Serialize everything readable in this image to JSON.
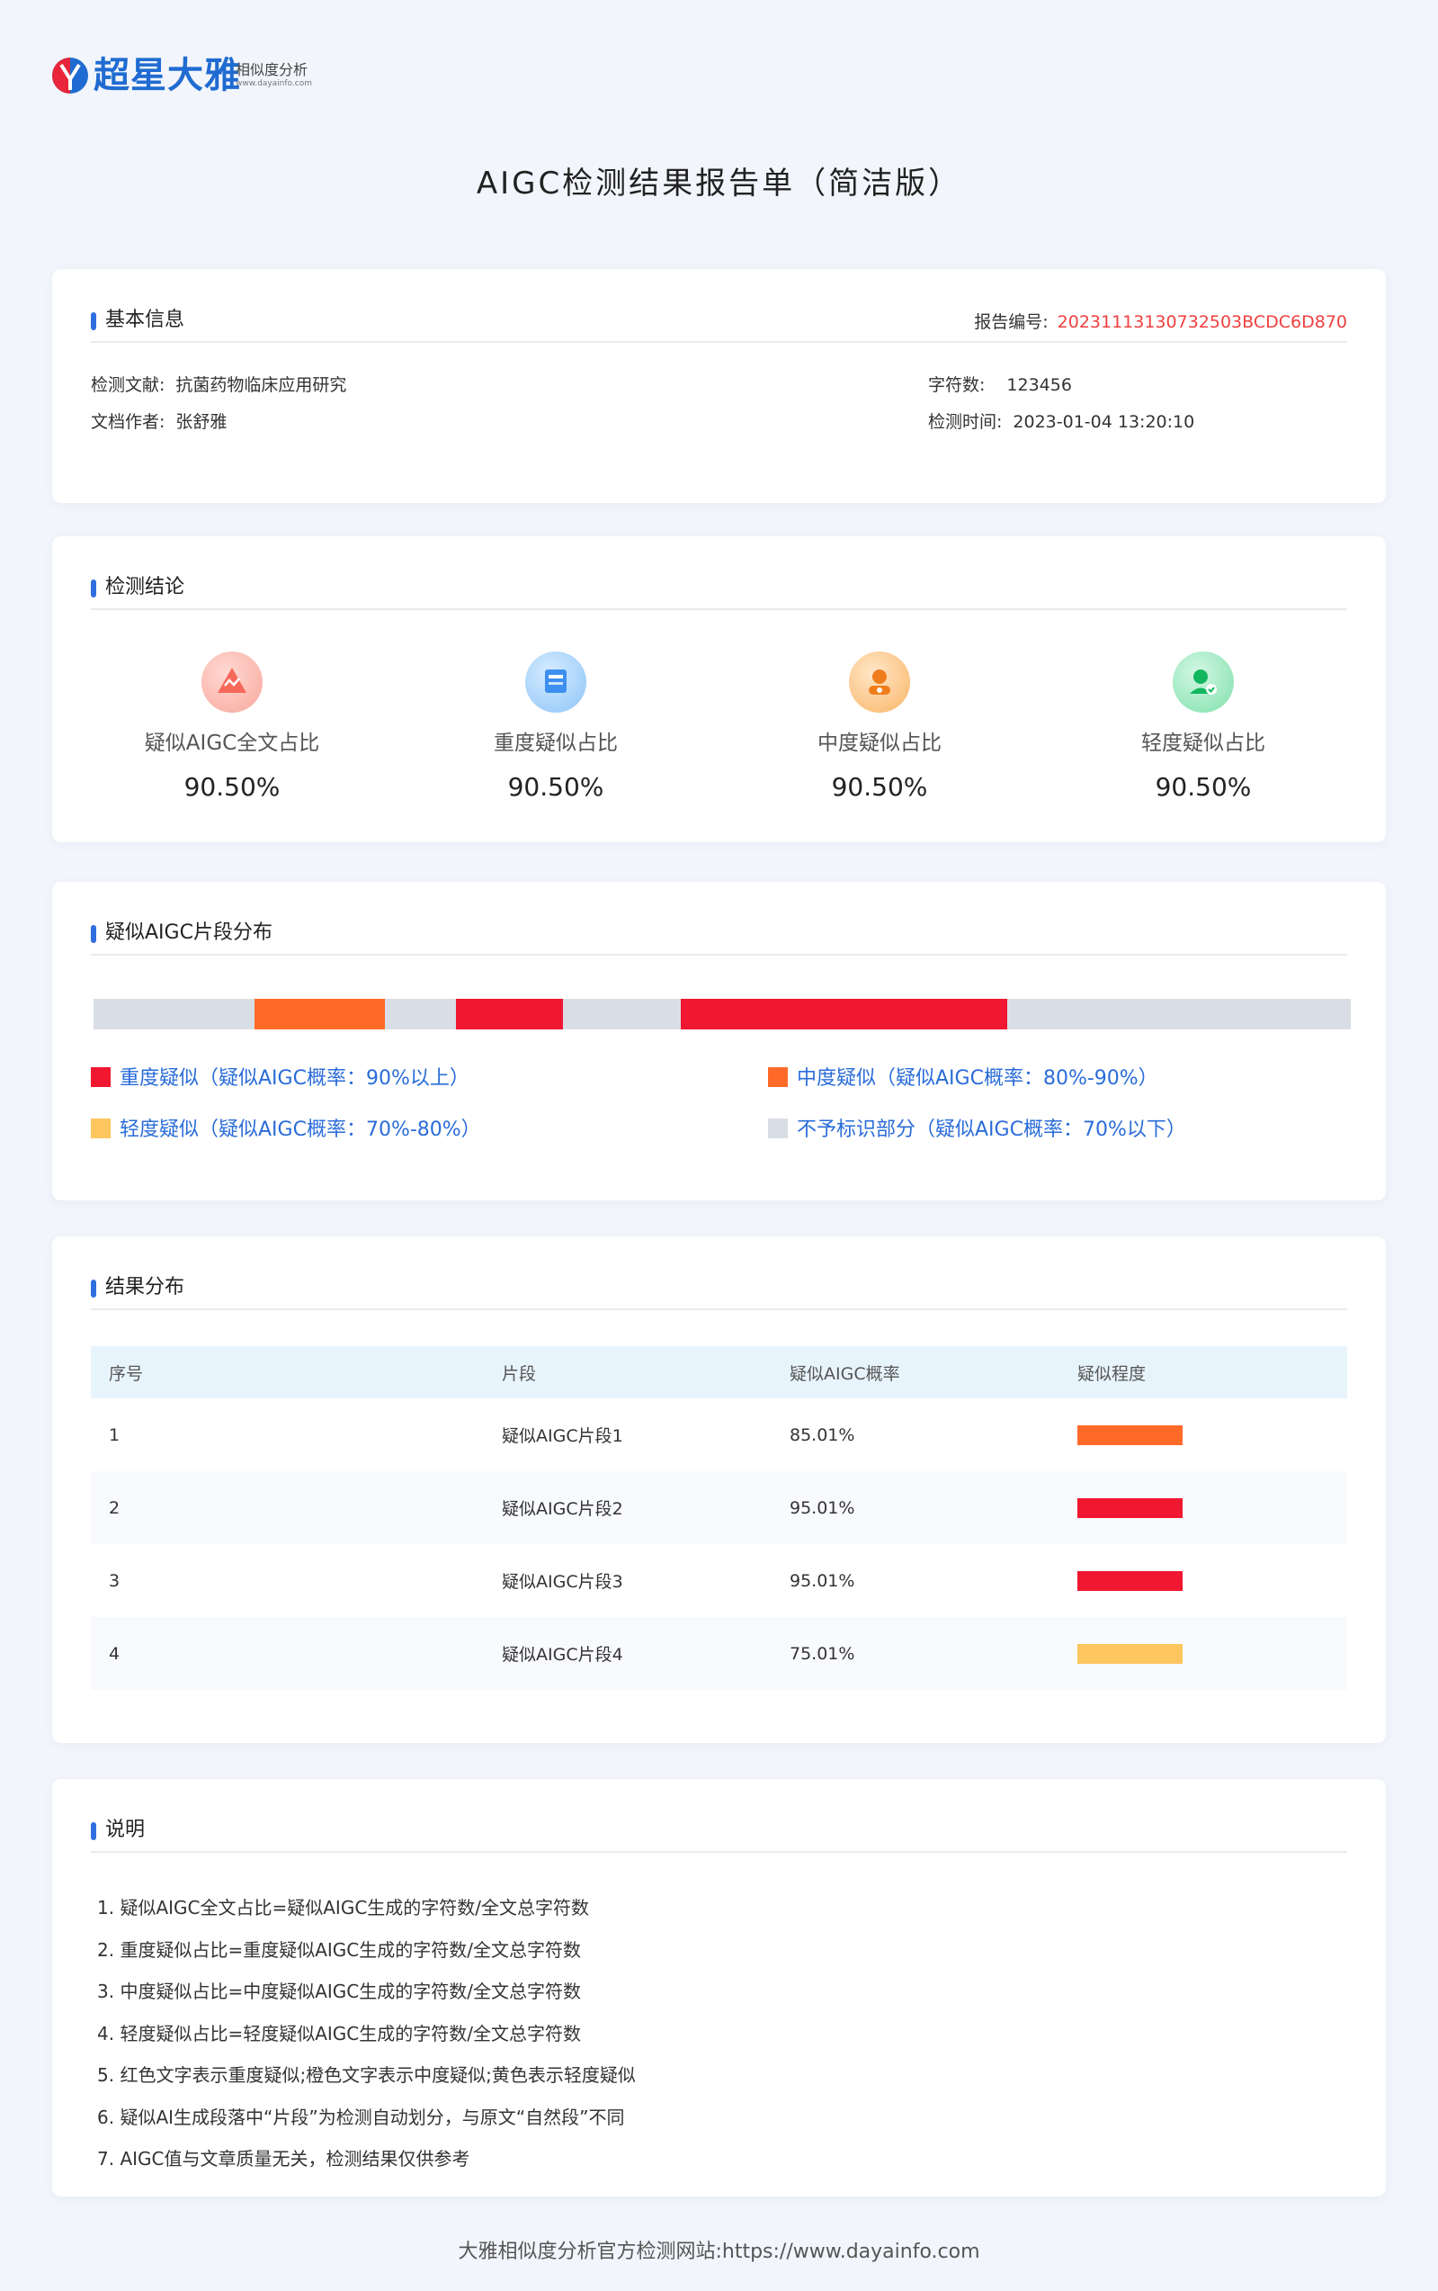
{
  "header": {
    "brand": "超星大雅",
    "subtitle": "相似度分析",
    "url": "www.dayainfo.com"
  },
  "title": "AIGC检测结果报告单（简洁版）",
  "basic": {
    "section_title": "基本信息",
    "report_no_label": "报告编号:",
    "report_no": "20231113130732503BCDC6D870",
    "doc_label": "检测文献:",
    "doc": "抗菌药物临床应用研究",
    "author_label": "文档作者:",
    "author": "张舒雅",
    "chars_label": "字符数:",
    "chars": "123456",
    "time_label": "检测时间:",
    "time": "2023-01-04 13:20:10"
  },
  "conclusion": {
    "section_title": "检测结论",
    "stats": [
      {
        "label": "疑似AIGC全文占比",
        "value": "90.50%",
        "icon": "ai-warning-icon",
        "color": "#f47a6e"
      },
      {
        "label": "重度疑似占比",
        "value": "90.50%",
        "icon": "document-scan-icon",
        "color": "#4f9ff0"
      },
      {
        "label": "中度疑似占比",
        "value": "90.50%",
        "icon": "robot-user-icon",
        "color": "#f59a3b"
      },
      {
        "label": "轻度疑似占比",
        "value": "90.50%",
        "icon": "user-check-icon",
        "color": "#2fcf7a"
      }
    ]
  },
  "distribution": {
    "section_title": "疑似AIGC片段分布",
    "segments": [
      {
        "start": 0.128,
        "end": 0.232,
        "level": "moderate"
      },
      {
        "start": 0.288,
        "end": 0.373,
        "level": "severe"
      },
      {
        "start": 0.467,
        "end": 0.727,
        "level": "severe"
      }
    ],
    "legend": [
      {
        "label": "重度疑似（疑似AIGC概率：90%以上）",
        "color": "#f01730"
      },
      {
        "label": "中度疑似（疑似AIGC概率：80%-90%）",
        "color": "#ff6a29"
      },
      {
        "label": "轻度疑似（疑似AIGC概率：70%-80%）",
        "color": "#fdc65e"
      },
      {
        "label": "不予标识部分（疑似AIGC概率：70%以下）",
        "color": "#d9dee6"
      }
    ]
  },
  "colors": {
    "severe": "#f01730",
    "moderate": "#ff6a29",
    "mild": "#fdc65e",
    "none": "#d9dee6"
  },
  "result": {
    "section_title": "结果分布",
    "columns": [
      "序号",
      "片段",
      "疑似AIGC概率",
      "疑似程度"
    ],
    "rows": [
      {
        "no": "1",
        "segment": "疑似AIGC片段1",
        "prob": "85.01%",
        "level": "moderate"
      },
      {
        "no": "2",
        "segment": "疑似AIGC片段2",
        "prob": "95.01%",
        "level": "severe"
      },
      {
        "no": "3",
        "segment": "疑似AIGC片段3",
        "prob": "95.01%",
        "level": "severe"
      },
      {
        "no": "4",
        "segment": "疑似AIGC片段4",
        "prob": "75.01%",
        "level": "mild"
      }
    ]
  },
  "notes": {
    "section_title": "说明",
    "items": [
      "1. 疑似AIGC全文占比=疑似AIGC生成的字符数/全文总字符数",
      "2. 重度疑似占比=重度疑似AIGC生成的字符数/全文总字符数",
      "3. 中度疑似占比=中度疑似AIGC生成的字符数/全文总字符数",
      "4. 轻度疑似占比=轻度疑似AIGC生成的字符数/全文总字符数",
      "5. 红色文字表示重度疑似;橙色文字表示中度疑似;黄色表示轻度疑似",
      "6. 疑似AI生成段落中“片段”为检测自动划分，与原文“自然段”不同",
      "7. AIGC值与文章质量无关，检测结果仅供参考"
    ]
  },
  "footer": "大雅相似度分析官方检测网站:https://www.dayainfo.com"
}
